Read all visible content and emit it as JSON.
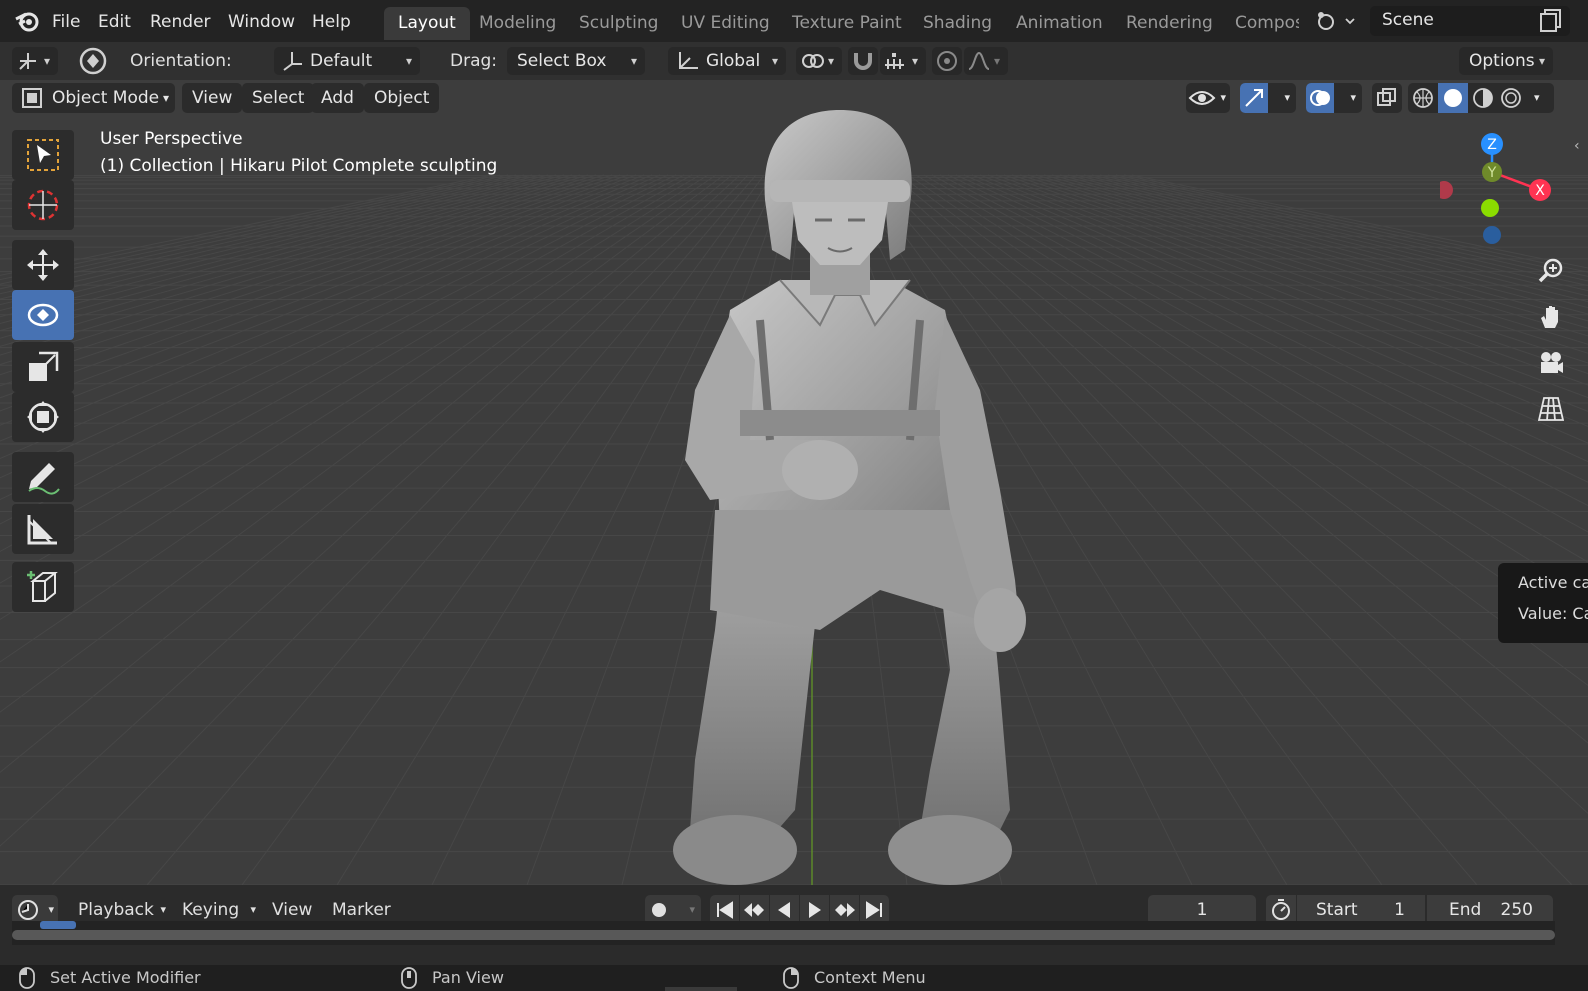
{
  "menu": [
    "File",
    "Edit",
    "Render",
    "Window",
    "Help"
  ],
  "workspaces": [
    "Layout",
    "Modeling",
    "Sculpting",
    "UV Editing",
    "Texture Paint",
    "Shading",
    "Animation",
    "Rendering",
    "Compos"
  ],
  "active_workspace": "Layout",
  "scene": "Scene",
  "tool_header": {
    "orientation_label": "Orientation:",
    "orientation_value": "Default",
    "drag_label": "Drag:",
    "drag_value": "Select Box",
    "transform_value": "Global",
    "options": "Options"
  },
  "viewport_header": {
    "mode": "Object Mode",
    "menus": [
      "View",
      "Select",
      "Add",
      "Object"
    ]
  },
  "viewport": {
    "view_name": "User Perspective",
    "collection_info": "(1) Collection | Hikaru Pilot Complete sculpting",
    "gizmo": {
      "z": "Z",
      "y": "Y",
      "x": "X"
    }
  },
  "tooltip": {
    "line1": "Active ca",
    "line2": "Value: Ca"
  },
  "toolbar_tools": [
    "select-box-tool",
    "cursor-tool",
    "move-tool",
    "rotate-tool",
    "scale-tool",
    "transform-tool",
    "annotate-tool",
    "measure-tool",
    "add-cube-tool"
  ],
  "active_tool": "rotate-tool",
  "timeline": {
    "menus": [
      "Playback",
      "Keying",
      "View",
      "Marker"
    ],
    "current_frame": "1",
    "start_label": "Start",
    "start_value": "1",
    "end_label": "End",
    "end_value": "250"
  },
  "statusbar": {
    "left": "Set Active Modifier",
    "middle": "Pan View",
    "right": "Context Menu"
  },
  "colors": {
    "accent": "#4772b3",
    "axis_x": "#ff3352",
    "axis_y": "#8bdc00",
    "axis_z": "#2890ff"
  }
}
